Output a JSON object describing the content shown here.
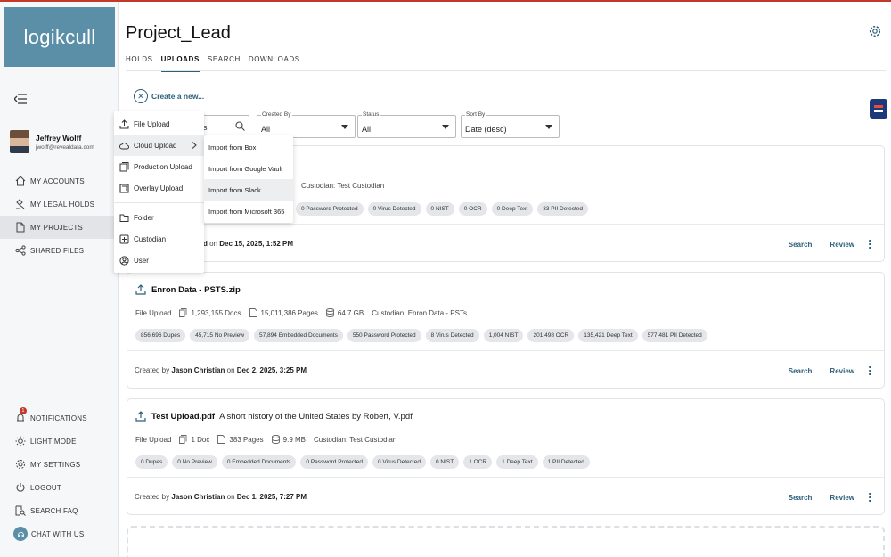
{
  "brand": {
    "logo_text": "logikcull",
    "accent": "#5b8fa8",
    "link_color": "#2c5f7a"
  },
  "user": {
    "name": "Jeffrey Wolff",
    "email": "jwolff@revealdata.com"
  },
  "sidebar": {
    "nav": [
      {
        "label": "MY ACCOUNTS",
        "icon": "home-icon"
      },
      {
        "label": "MY LEGAL HOLDS",
        "icon": "gavel-icon"
      },
      {
        "label": "MY PROJECTS",
        "icon": "document-icon",
        "active": true
      },
      {
        "label": "SHARED FILES",
        "icon": "share-icon"
      }
    ],
    "bottom": [
      {
        "label": "NOTIFICATIONS",
        "icon": "bell-icon",
        "badge": "1"
      },
      {
        "label": "LIGHT MODE",
        "icon": "sun-icon"
      },
      {
        "label": "MY SETTINGS",
        "icon": "gear-icon"
      },
      {
        "label": "LOGOUT",
        "icon": "power-icon"
      },
      {
        "label": "SEARCH FAQ",
        "icon": "search-doc-icon"
      },
      {
        "label": "CHAT WITH US",
        "icon": "chat-icon"
      }
    ]
  },
  "page": {
    "title": "Project_Lead",
    "create_label": "Create a new..."
  },
  "tabs": [
    {
      "label": "HOLDS"
    },
    {
      "label": "UPLOADS",
      "active": true
    },
    {
      "label": "SEARCH"
    },
    {
      "label": "DOWNLOADS"
    }
  ],
  "filters": {
    "search_partial": "s",
    "created_by": {
      "label": "Created By",
      "value": "All"
    },
    "status": {
      "label": "Status",
      "value": "All"
    },
    "sort_by": {
      "label": "Sort By",
      "value": "Date (desc)"
    }
  },
  "menu": {
    "items": [
      {
        "label": "File Upload",
        "icon": "upload-icon"
      },
      {
        "label": "Cloud Upload",
        "icon": "cloud-icon",
        "has_submenu": true
      },
      {
        "label": "Production Upload",
        "icon": "production-icon"
      },
      {
        "label": "Overlay Upload",
        "icon": "overlay-icon"
      }
    ],
    "items2": [
      {
        "label": "Folder",
        "icon": "folder-icon"
      },
      {
        "label": "Custodian",
        "icon": "plus-box-icon"
      },
      {
        "label": "User",
        "icon": "user-icon"
      }
    ],
    "cloud_submenu": [
      {
        "label": "Import from Box"
      },
      {
        "label": "Import from Google Vault"
      },
      {
        "label": "Import from Slack"
      },
      {
        "label": "Import from Microsoft 365"
      }
    ]
  },
  "cards": [
    {
      "custodian": "Custodian: Test Custodian",
      "pills": [
        "0 Password Protected",
        "0 Virus Detected",
        "0 NIST",
        "0 OCR",
        "0 Deep Text",
        "33 PII Detected"
      ],
      "created_prefix": "d",
      "created_on": "on",
      "created_date": "Dec 15, 2025, 1:52 PM",
      "search": "Search",
      "review": "Review"
    },
    {
      "name": "Enron Data - PSTS.zip",
      "type": "File Upload",
      "docs": "1,293,155 Docs",
      "pages": "15,011,386 Pages",
      "size": "64.7 GB",
      "custodian": "Custodian: Enron Data - PSTs",
      "pills": [
        "856,696 Dupes",
        "45,715 No Preview",
        "57,894 Embedded Documents",
        "550 Password Protected",
        "8 Virus Detected",
        "1,004 NIST",
        "201,498 OCR",
        "135,421 Deep Text",
        "577,481 PII Detected"
      ],
      "created_by_label": "Created by",
      "created_by": "Jason Christian",
      "created_on": "on",
      "created_date": "Dec 2, 2025, 3:25 PM",
      "search": "Search",
      "review": "Review"
    },
    {
      "name": "Test Upload.pdf",
      "subtitle": "A short history of the United States by Robert, V.pdf",
      "type": "File Upload",
      "docs": "1 Doc",
      "pages": "383 Pages",
      "size": "9.9 MB",
      "custodian": "Custodian: Test Custodian",
      "pills": [
        "0 Dupes",
        "0 No Preview",
        "0 Embedded Documents",
        "0 Password Protected",
        "0 Virus Detected",
        "0 NIST",
        "1 OCR",
        "1 Deep Text",
        "1 PII Detected"
      ],
      "created_by_label": "Created by",
      "created_by": "Jason Christian",
      "created_on": "on",
      "created_date": "Dec 1, 2025, 7:27 PM",
      "search": "Search",
      "review": "Review"
    }
  ]
}
